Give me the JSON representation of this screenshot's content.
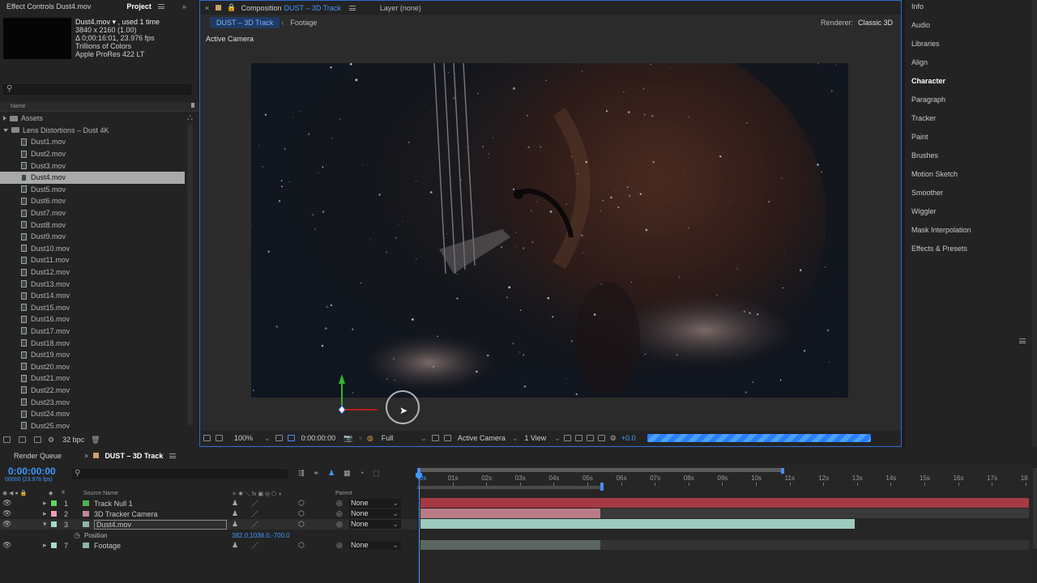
{
  "left_panel": {
    "tab_effect_controls": "Effect Controls Dust4.mov",
    "tab_project": "Project",
    "footage_info": {
      "name": "Dust4.mov ▾ , used 1 time",
      "size": "3840 x 2160 (1.00)",
      "duration": "Δ 0;00:16:01, 23.976 fps",
      "colors": "Trillions of Colors",
      "codec": "Apple ProRes 422 LT"
    },
    "search_placeholder": "",
    "column_name": "Name",
    "folders": [
      {
        "label": "Assets"
      },
      {
        "label": "Lens Distortions – Dust 4K"
      }
    ],
    "files": [
      "Dust1.mov",
      "Dust2.mov",
      "Dust3.mov",
      "Dust4.mov",
      "Dust5.mov",
      "Dust6.mov",
      "Dust7.mov",
      "Dust8.mov",
      "Dust9.mov",
      "Dust10.mov",
      "Dust11.mov",
      "Dust12.mov",
      "Dust13.mov",
      "Dust14.mov",
      "Dust15.mov",
      "Dust16.mov",
      "Dust17.mov",
      "Dust18.mov",
      "Dust19.mov",
      "Dust20.mov",
      "Dust21.mov",
      "Dust22.mov",
      "Dust23.mov",
      "Dust24.mov",
      "Dust25.mov"
    ],
    "selected_file": "Dust4.mov",
    "bpc": "32 bpc"
  },
  "comp_panel": {
    "tab_composition": "Composition",
    "comp_name": "DUST – 3D Track",
    "tab_layer": "Layer (none)",
    "breadcrumb_comp": "DUST – 3D Track",
    "breadcrumb_footage": "Footage",
    "renderer_label": "Renderer:",
    "renderer_value": "Classic 3D",
    "view_label": "Active Camera",
    "zoom": "100%",
    "timecode": "0:00:00:00",
    "resolution": "Full",
    "camera": "Active Camera",
    "views": "1 View",
    "exposure": "+0.0"
  },
  "right_panel": {
    "items": [
      "Info",
      "Audio",
      "Libraries",
      "Align",
      "Character",
      "Paragraph",
      "Tracker",
      "Paint",
      "Brushes",
      "Motion Sketch",
      "Smoother",
      "Wiggler",
      "Mask Interpolation",
      "Effects & Presets"
    ]
  },
  "timeline": {
    "tab_render_queue": "Render Queue",
    "tab_comp": "DUST – 3D Track",
    "current_time": "0:00:00:00",
    "frame_info": "00000 (23.976 fps)",
    "col_source_name": "Source Name",
    "col_parent": "Parent",
    "ruler": [
      "0s",
      "01s",
      "02s",
      "03s",
      "04s",
      "05s",
      "06s",
      "07s",
      "08s",
      "09s",
      "10s",
      "11s",
      "12s",
      "13s",
      "14s",
      "15s",
      "16s",
      "17s",
      "18"
    ],
    "layers": [
      {
        "num": "1",
        "name": "Track Null 1",
        "parent": "None",
        "color": "#5fd35f"
      },
      {
        "num": "2",
        "name": "3D Tracker Camera",
        "parent": "None",
        "color": "#e8a0b0"
      },
      {
        "num": "3",
        "name": "Dust4.mov",
        "parent": "None",
        "color": "#a5d9cc"
      },
      {
        "num": "7",
        "name": "Footage",
        "parent": "None",
        "color": "#a5d9cc"
      }
    ],
    "position_label": "Position",
    "position_value": "382.0,1038.0,-700.0"
  },
  "colors": {
    "accent": "#3d98ff",
    "null_bar": "#a43a42",
    "camera_bar": "#b97c86",
    "dust_bar": "#9ec9bd",
    "footage_bar": "#5b6660"
  }
}
